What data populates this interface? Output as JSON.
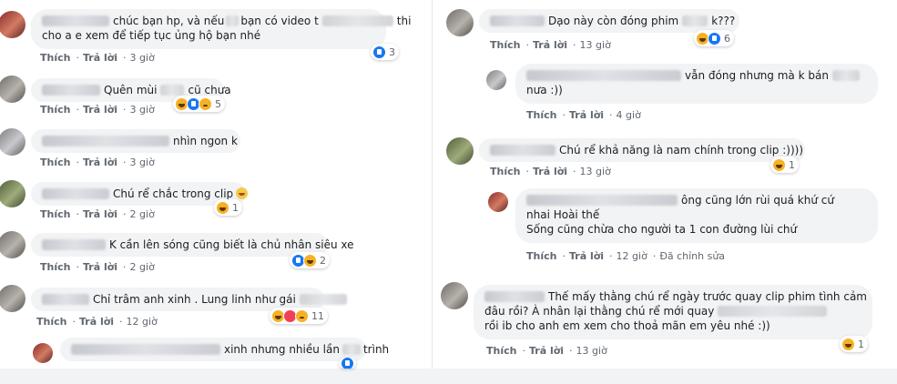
{
  "actions": {
    "like": "Thích",
    "reply": "Trả lời",
    "edited": "Đã chỉnh sửa"
  },
  "left_comments": [
    {
      "line1": "chúc bạn hp, và nếu",
      "line1b": "bạn có video t",
      "line1c": "thi",
      "line2": "cho a e xem để tiếp tục ủng hộ bạn nhé",
      "time": "3 giờ",
      "reaction_count": "3"
    },
    {
      "text_a": "Quên mùi",
      "text_b": "cũ chưa",
      "time": "3 giờ",
      "reaction_count": "5"
    },
    {
      "text": "nhìn ngon k",
      "time": "3 giờ"
    },
    {
      "text": "Chú rể chắc trong clip",
      "time": "2 giờ",
      "reaction_count": "1"
    },
    {
      "text": "K cần lên sóng cũng biết là chủ nhân siêu xe",
      "time": "2 giờ",
      "reaction_count": "2"
    },
    {
      "text": "Chỉ trâm anh xinh . Lung linh như gái",
      "time": "12 giờ",
      "reaction_count": "11"
    },
    {
      "text_a": "xinh nhưng nhiều lần",
      "text_b": "trình"
    }
  ],
  "right_comments": [
    {
      "text_a": "Dạo này còn đóng phim",
      "text_b": "k???",
      "time": "13 giờ",
      "reaction_count": "6"
    },
    {
      "line1": "vẫn đóng nhưng mà k bán",
      "line2": "nưa :))",
      "time": "4 giờ"
    },
    {
      "text": "Chú rể khả năng là nam chính trong clip :))))",
      "time": "13 giờ",
      "reaction_count": "1"
    },
    {
      "line1": "ông cũng lớn rùi quá khứ cứ",
      "line2": "nhai Hoài thế",
      "line3": "Sống cũng chừa cho người ta 1 con đường lùi chứ",
      "time": "12 giờ"
    },
    {
      "line1": "Thế mấy thằng chú rể ngày trước quay clip phim tình cảm",
      "line2": "đâu rồi? À nhân lại thằng chú rể mới quay",
      "line3": "rồi ib cho anh em xem cho thoả mãn em yêu nhé :))",
      "time": "13 giờ",
      "reaction_count": "1"
    }
  ]
}
